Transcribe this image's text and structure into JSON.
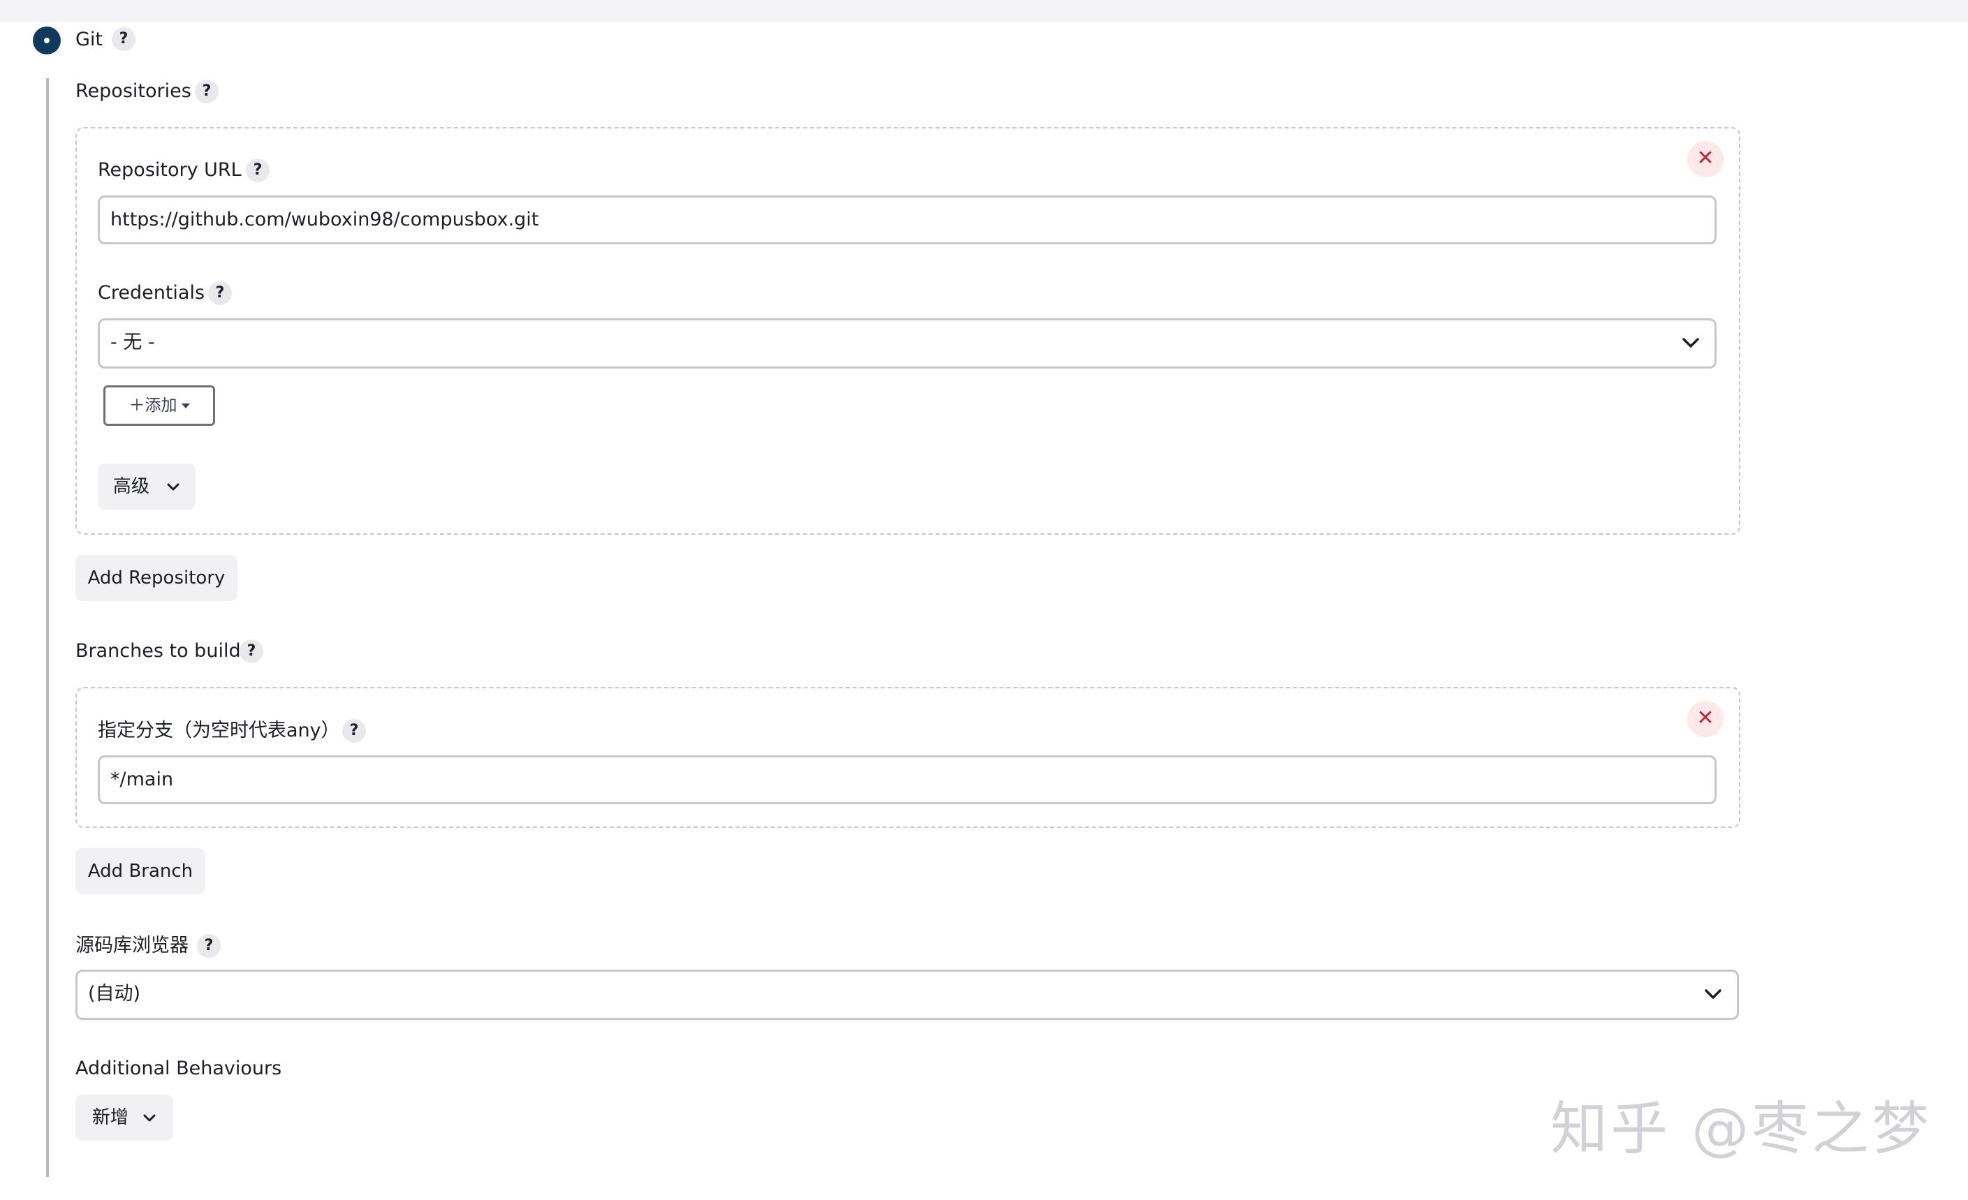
{
  "scm": {
    "option_label": "Git",
    "repositories_label": "Repositories",
    "repository": {
      "url_label": "Repository URL",
      "url_value": "https://github.com/wuboxin98/compusbox.git",
      "credentials_label": "Credentials",
      "credentials_value": "- 无 -",
      "add_button_label": "添加",
      "advanced_button_label": "高级"
    },
    "add_repository_label": "Add Repository",
    "branches_label": "Branches to build",
    "branch": {
      "specifier_label": "指定分支（为空时代表any）",
      "specifier_value": "*/main"
    },
    "add_branch_label": "Add Branch",
    "browser_label": "源码库浏览器",
    "browser_value": "(自动)",
    "additional_behaviours_label": "Additional Behaviours",
    "new_button_label": "新增"
  },
  "help_glyph": "?",
  "close_glyph": "✕",
  "plus_glyph": "＋",
  "watermark": "知乎 @枣之梦",
  "colors": {
    "radio_selected": "#0f3a5e",
    "close_bg": "#fde8ea",
    "close_fg": "#c0283a"
  }
}
